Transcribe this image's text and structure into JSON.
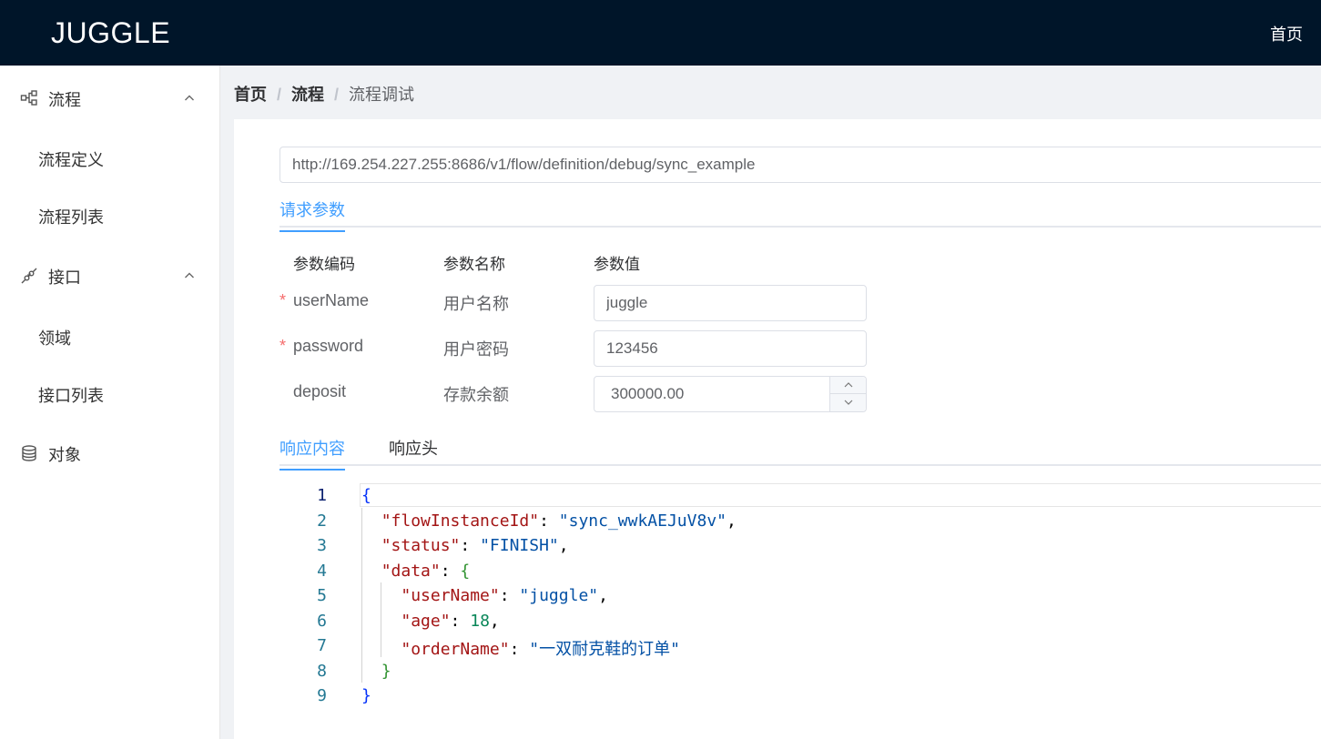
{
  "app": {
    "logo": "JUGGLE",
    "top_nav_home": "首页"
  },
  "sidebar": {
    "groups": [
      {
        "label": "流程",
        "icon": "flow-icon",
        "expanded": true,
        "items": [
          {
            "label": "流程定义"
          },
          {
            "label": "流程列表"
          }
        ]
      },
      {
        "label": "接口",
        "icon": "api-link-icon",
        "expanded": true,
        "items": [
          {
            "label": "领域"
          },
          {
            "label": "接口列表"
          }
        ]
      },
      {
        "label": "对象",
        "icon": "database-icon",
        "expanded": false,
        "items": []
      }
    ]
  },
  "breadcrumb": {
    "items": [
      "首页",
      "流程"
    ],
    "current": "流程调试",
    "separator": "/"
  },
  "debug": {
    "url": "http://169.254.227.255:8686/v1/flow/definition/debug/sync_example",
    "request_tab": "请求参数",
    "columns": {
      "code": "参数编码",
      "name": "参数名称",
      "value": "参数值"
    },
    "params": [
      {
        "code": "userName",
        "name": "用户名称",
        "value": "juggle",
        "required": true
      },
      {
        "code": "password",
        "name": "用户密码",
        "value": "123456",
        "required": true
      },
      {
        "code": "deposit",
        "name": "存款余额",
        "value": "300000.00",
        "required": false
      }
    ],
    "required_marker": "*",
    "response_tabs": [
      "响应内容",
      "响应头"
    ],
    "active_response_tab": 0
  },
  "response": {
    "line_numbers": [
      "1",
      "2",
      "3",
      "4",
      "5",
      "6",
      "7",
      "8",
      "9"
    ],
    "brace_open": "{",
    "brace_close": "}",
    "flowInstanceId_key": "\"flowInstanceId\"",
    "flowInstanceId_value": "\"sync_wwkAEJuV8v\"",
    "status_key": "\"status\"",
    "status_value": "\"FINISH\"",
    "data_key": "\"data\"",
    "userName_key": "\"userName\"",
    "userName_value": "\"juggle\"",
    "age_key": "\"age\"",
    "age_value": "18",
    "orderName_key": "\"orderName\"",
    "orderName_value": "\"一双耐克鞋的订单\""
  },
  "colors": {
    "header_bg": "#001529",
    "accent": "#409eff",
    "required": "#f56c6c"
  }
}
